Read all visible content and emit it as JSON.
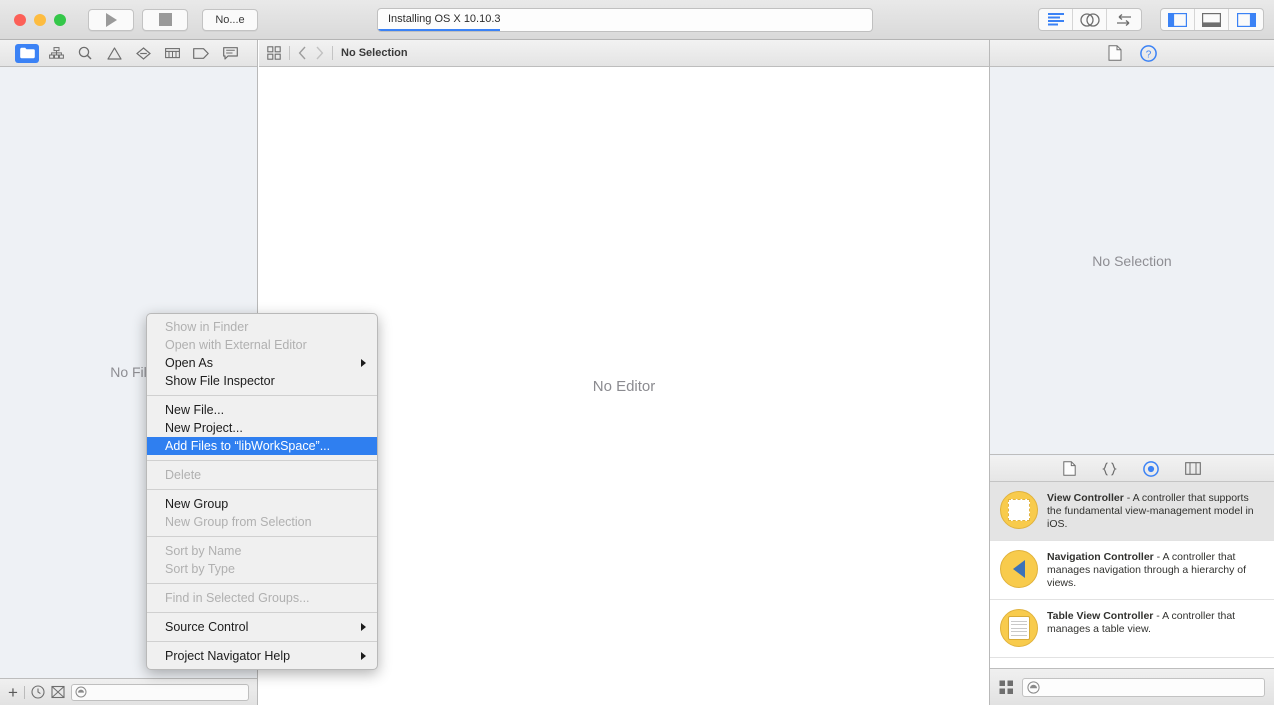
{
  "window": {
    "traffic_lights": [
      "close",
      "minimize",
      "zoom"
    ],
    "run_label": "Run",
    "stop_label": "Stop",
    "scheme_label": "No...e",
    "status_text": "Installing OS X 10.10.3",
    "progress_percent": 25
  },
  "toolbar_right": {
    "editor_modes": [
      "standard-editor",
      "assistant-editor",
      "version-editor"
    ],
    "view_toggles": [
      "toggle-navigator",
      "toggle-debug-area",
      "toggle-utilities"
    ]
  },
  "navigator": {
    "tabs": [
      {
        "name": "project-navigator",
        "icon": "folder-icon",
        "selected": true
      },
      {
        "name": "symbol-navigator",
        "icon": "hierarchy-icon",
        "selected": false
      },
      {
        "name": "find-navigator",
        "icon": "search-icon",
        "selected": false
      },
      {
        "name": "issue-navigator",
        "icon": "warning-triangle-icon",
        "selected": false
      },
      {
        "name": "test-navigator",
        "icon": "diamond-icon",
        "selected": false
      },
      {
        "name": "debug-navigator",
        "icon": "gauge-icon",
        "selected": false
      },
      {
        "name": "breakpoint-navigator",
        "icon": "tag-icon",
        "selected": false
      },
      {
        "name": "report-navigator",
        "icon": "speech-bubble-icon",
        "selected": false
      }
    ],
    "empty_label": "No Fil",
    "bottom_bar": {
      "add_label": "+",
      "recent_icon": "clock-icon",
      "source_control_icon": "sourcecontrol-icon",
      "filter_placeholder": ""
    }
  },
  "editor": {
    "jumpbar": {
      "related_items_icon": "grid-icon",
      "back_icon": "chevron-left-icon",
      "forward_icon": "chevron-right-icon",
      "path_label": "No Selection"
    },
    "empty_label": "No Editor"
  },
  "utilities": {
    "tabs": [
      {
        "name": "file-inspector",
        "icon": "document-icon",
        "selected": false
      },
      {
        "name": "quick-help-inspector",
        "icon": "question-circle-icon",
        "selected": true
      }
    ],
    "quick_help_empty": "No Selection",
    "library_tabs": [
      {
        "name": "file-template-library",
        "icon": "document-icon",
        "selected": false
      },
      {
        "name": "code-snippet-library",
        "icon": "braces-icon",
        "selected": false
      },
      {
        "name": "object-library",
        "icon": "circle-target-icon",
        "selected": true
      },
      {
        "name": "media-library",
        "icon": "media-icon",
        "selected": false
      }
    ],
    "library_items": [
      {
        "icon": "view-controller-icon",
        "title": "View Controller",
        "description": " - A controller that supports the fundamental view-management model in iOS.",
        "selected": true
      },
      {
        "icon": "navigation-controller-icon",
        "title": "Navigation Controller",
        "description": " - A controller that manages navigation through a hierarchy of views.",
        "selected": false
      },
      {
        "icon": "table-view-controller-icon",
        "title": "Table View Controller",
        "description": " - A controller that manages a table view.",
        "selected": false
      }
    ],
    "library_bottom": {
      "layout_icon": "grid-icon",
      "search_placeholder": ""
    }
  },
  "context_menu": {
    "items": [
      {
        "label": "Show in Finder",
        "state": "disabled",
        "submenu": false
      },
      {
        "label": "Open with External Editor",
        "state": "disabled",
        "submenu": false
      },
      {
        "label": "Open As",
        "state": "normal",
        "submenu": true
      },
      {
        "label": "Show File Inspector",
        "state": "normal",
        "submenu": false
      },
      {
        "separator": true
      },
      {
        "label": "New File...",
        "state": "normal",
        "submenu": false
      },
      {
        "label": "New Project...",
        "state": "normal",
        "submenu": false
      },
      {
        "label": "Add Files to “libWorkSpace”...",
        "state": "highlighted",
        "submenu": false
      },
      {
        "separator": true
      },
      {
        "label": "Delete",
        "state": "disabled",
        "submenu": false
      },
      {
        "separator": true
      },
      {
        "label": "New Group",
        "state": "normal",
        "submenu": false
      },
      {
        "label": "New Group from Selection",
        "state": "disabled",
        "submenu": false
      },
      {
        "separator": true
      },
      {
        "label": "Sort by Name",
        "state": "disabled",
        "submenu": false
      },
      {
        "label": "Sort by Type",
        "state": "disabled",
        "submenu": false
      },
      {
        "separator": true
      },
      {
        "label": "Find in Selected Groups...",
        "state": "disabled",
        "submenu": false
      },
      {
        "separator": true
      },
      {
        "label": "Source Control",
        "state": "normal",
        "submenu": true
      },
      {
        "separator": true
      },
      {
        "label": "Project Navigator Help",
        "state": "normal",
        "submenu": true
      }
    ]
  },
  "colors": {
    "accent_blue": "#3b82f5",
    "menu_highlight": "#2f7ff0",
    "library_yellow": "#f8cb4c",
    "chevron_blue": "#3c72b8"
  }
}
